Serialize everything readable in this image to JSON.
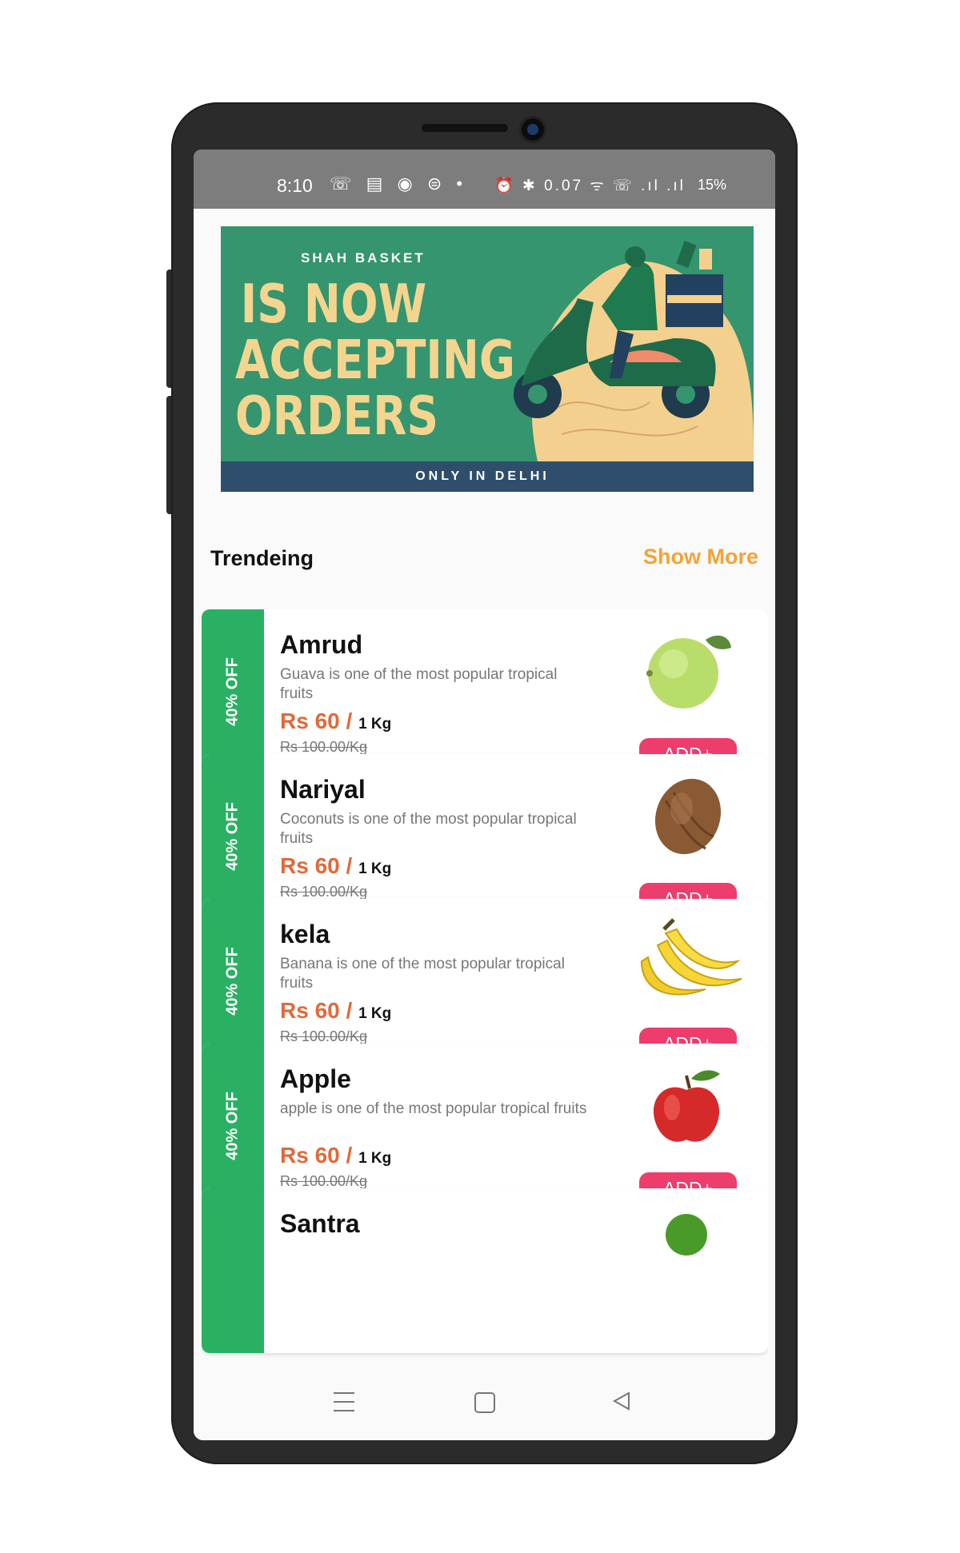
{
  "status_bar": {
    "time": "8:10",
    "left_icons": "☏ ▤ ◉ ⊜ •",
    "right_icons": "⏰ ✱ 0.07 ᯤ ☏ .ıl .ıl",
    "battery": "15%",
    "icon_names": [
      "missed-call-icon",
      "news-icon",
      "app-icon",
      "messages-icon",
      "dot-icon",
      "alarm-icon",
      "bluetooth-icon",
      "data-speed-icon",
      "wifi-icon",
      "volte-icon",
      "signal-icon",
      "signal-icon",
      "battery-icon"
    ]
  },
  "banner": {
    "brand": "SHAH BASKET",
    "headline": "IS NOW ACCEPTING ORDERS",
    "footer": "ONLY IN DELHI"
  },
  "section": {
    "title": "Trendeing",
    "show_more": "Show More"
  },
  "products": [
    {
      "badge": "40% OFF",
      "name": "Amrud",
      "desc": "Guava is one of the most popular tropical fruits",
      "price": "Rs 60 /",
      "unit": "1 Kg",
      "mrp": "Rs 100.00/Kg",
      "add": "ADD+",
      "fruit": "guava"
    },
    {
      "badge": "40% OFF",
      "name": "Nariyal",
      "desc": "Coconuts is one of the most popular tropical fruits",
      "price": "Rs 60 /",
      "unit": "1 Kg",
      "mrp": "Rs 100.00/Kg",
      "add": "ADD+",
      "fruit": "coconut"
    },
    {
      "badge": "40% OFF",
      "name": "kela",
      "desc": "Banana is one of the most popular tropical fruits",
      "price": "Rs 60 /",
      "unit": "1 Kg",
      "mrp": "Rs 100.00/Kg",
      "add": "ADD+",
      "fruit": "banana"
    },
    {
      "badge": "40% OFF",
      "name": "Apple",
      "desc": "apple is one of the most popular tropical fruits",
      "price": "Rs 60 /",
      "unit": "1 Kg",
      "mrp": "Rs 100.00/Kg",
      "add": "ADD+",
      "fruit": "apple"
    },
    {
      "badge": "",
      "name": "Santra",
      "fruit": "orange"
    }
  ],
  "colors": {
    "ribbon_green": "#2ab062",
    "add_pink": "#ec3d6c",
    "price_orange": "#e06a3a",
    "show_more_orange": "#f3a33a",
    "banner_green": "#34956f",
    "banner_navy": "#2e4e6b",
    "banner_yellow": "#f4d58f"
  }
}
